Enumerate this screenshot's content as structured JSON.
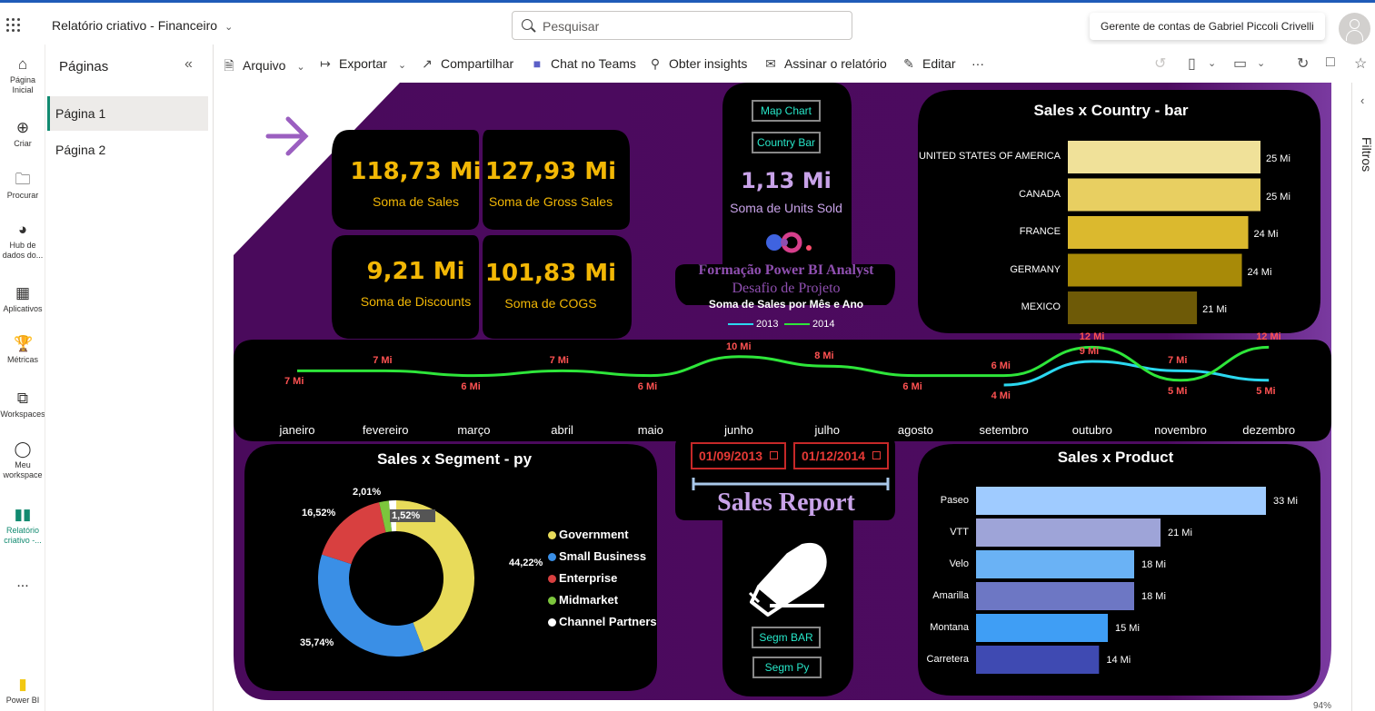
{
  "app": {
    "title": "Relatório criativo - Financeiro",
    "search_placeholder": "Pesquisar",
    "account_tooltip": "Gerente de contas de Gabriel Piccoli Crivelli"
  },
  "leftrail": [
    {
      "label": "Página Inicial",
      "icon": "home-icon"
    },
    {
      "label": "Criar",
      "icon": "plus-icon"
    },
    {
      "label": "Procurar",
      "icon": "folder-icon"
    },
    {
      "label": "Hub de dados do...",
      "icon": "data-hub-icon"
    },
    {
      "label": "Aplicativos",
      "icon": "apps-icon"
    },
    {
      "label": "Métricas",
      "icon": "trophy-icon"
    },
    {
      "label": "Workspaces",
      "icon": "workspaces-icon"
    },
    {
      "label": "Meu workspace",
      "icon": "person-icon"
    },
    {
      "label": "Relatório criativo -...",
      "icon": "report-icon"
    },
    {
      "label": "...",
      "icon": "more-icon"
    },
    {
      "label": "Power BI",
      "icon": "powerbi-icon"
    }
  ],
  "pages_pane": {
    "title": "Páginas",
    "pages": [
      "Página 1",
      "Página 2"
    ]
  },
  "toolbar": {
    "arquivo": "Arquivo",
    "exportar": "Exportar",
    "compartilhar": "Compartilhar",
    "chat": "Chat no Teams",
    "insights": "Obter insights",
    "assinar": "Assinar o relatório",
    "editar": "Editar",
    "more": "···"
  },
  "filters": {
    "label": "Filtros"
  },
  "status": {
    "zoom": "94%"
  },
  "report": {
    "kpis": [
      {
        "value": "118,73 Mi",
        "label": "Soma de  Sales"
      },
      {
        "value": "127,93 Mi",
        "label": "Soma de Gross Sales"
      },
      {
        "value": "9,21 Mi",
        "label": "Soma de Discounts"
      },
      {
        "value": "101,83 Mi",
        "label": "Soma de COGS"
      }
    ],
    "units": {
      "value": "1,13 Mi",
      "label": "Soma de Units Sold"
    },
    "nav_buttons": {
      "map": "Map Chart",
      "country_bar": "Country Bar",
      "segm_bar": "Segm BAR",
      "segm_py": "Segm Py"
    },
    "branding": {
      "formacao": "Formação Power BI Analyst",
      "desafio": "Desafio de Projeto"
    },
    "dates": {
      "start": "01/09/2013",
      "end": "01/12/2014"
    },
    "report_title": "Sales Report",
    "colors": {
      "purple_bg": "#4a0a5c",
      "kpi_yellow": "#f2b705",
      "line_2014": "#2ee63a",
      "line_2013": "#2bd8f0"
    }
  },
  "chart_data": [
    {
      "type": "bar",
      "title": "Sales x Country - bar",
      "categories": [
        "UNITED STATES OF AMERICA",
        "CANADA",
        "FRANCE",
        "GERMANY",
        "MEXICO"
      ],
      "values": [
        25,
        25,
        24,
        24,
        21
      ],
      "value_labels": [
        "25 Mi",
        "25 Mi",
        "24 Mi",
        "24 Mi",
        "21 Mi"
      ],
      "colors": [
        "#f0e199",
        "#e8cf61",
        "#dbb92e",
        "#a88a08",
        "#6e5a07"
      ]
    },
    {
      "type": "line",
      "title": "Soma de Sales por Mês e Ano",
      "categories": [
        "janeiro",
        "fevereiro",
        "março",
        "abril",
        "maio",
        "junho",
        "julho",
        "agosto",
        "setembro",
        "outubro",
        "novembro",
        "dezembro"
      ],
      "series": [
        {
          "name": "2013",
          "values": [
            null,
            null,
            null,
            null,
            null,
            null,
            null,
            null,
            4,
            9,
            7,
            5
          ],
          "labels": [
            "",
            "",
            "",
            "",
            "",
            "",
            "",
            "",
            "4 Mi",
            "9 Mi",
            "7 Mi",
            "5 Mi"
          ],
          "color": "#2bd8f0"
        },
        {
          "name": "2014",
          "values": [
            7,
            7,
            6,
            7,
            6,
            10,
            8,
            6,
            6,
            12,
            5,
            12
          ],
          "labels": [
            "7 Mi",
            "7 Mi",
            "6 Mi",
            "7 Mi",
            "6 Mi",
            "10 Mi",
            "8 Mi",
            "6 Mi",
            "6 Mi",
            "12 Mi",
            "5 Mi",
            "12 Mi"
          ],
          "color": "#2ee63a"
        }
      ],
      "legend": [
        "2013",
        "2014"
      ]
    },
    {
      "type": "pie",
      "title": "Sales x Segment - py",
      "labels": [
        "Government",
        "Small Business",
        "Enterprise",
        "Midmarket",
        "Channel Partners"
      ],
      "values": [
        44.22,
        35.74,
        16.52,
        2.01,
        1.52
      ],
      "value_labels": [
        "44,22%",
        "35,74%",
        "16,52%",
        "2,01%",
        "1,52%"
      ],
      "colors": [
        "#e8db5a",
        "#3a8fe6",
        "#d84040",
        "#7cc63c",
        "#ffffff"
      ]
    },
    {
      "type": "bar",
      "title": "Sales x Product",
      "categories": [
        "Paseo",
        "VTT",
        "Velo",
        "Amarilla",
        "Montana",
        "Carretera"
      ],
      "values": [
        33,
        21,
        18,
        18,
        15,
        14
      ],
      "value_labels": [
        "33 Mi",
        "21 Mi",
        "18 Mi",
        "18 Mi",
        "15 Mi",
        "14 Mi"
      ],
      "colors": [
        "#9fcbff",
        "#9ea4d8",
        "#6ab2f5",
        "#6d77c4",
        "#3f9ef5",
        "#3f4ab2"
      ]
    }
  ]
}
